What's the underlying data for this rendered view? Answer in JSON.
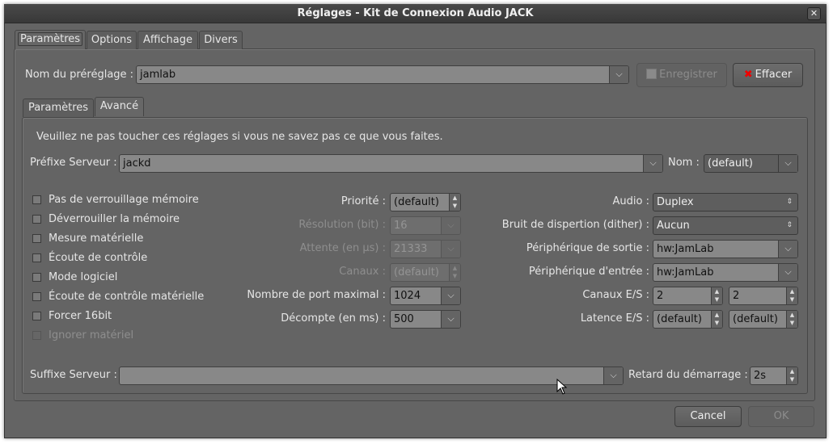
{
  "window": {
    "title": "Réglages - Kit de Connexion Audio JACK",
    "close": "✕"
  },
  "outer_tabs": [
    "Paramètres",
    "Options",
    "Affichage",
    "Divers"
  ],
  "preset": {
    "label": "Nom du préréglage :",
    "value": "jamlab",
    "save": "Enregistrer",
    "delete": "Effacer"
  },
  "inner_tabs": [
    "Paramètres",
    "Avancé"
  ],
  "warning": "Veuillez ne pas toucher ces réglages si vous ne savez pas ce que vous faites.",
  "server_prefix": {
    "label": "Préfixe Serveur :",
    "value": "jackd",
    "name_label": "Nom :",
    "name_value": "(default)"
  },
  "checkboxes": [
    "Pas de verrouillage mémoire",
    "Déverrouiller la mémoire",
    "Mesure matérielle",
    "Écoute de contrôle",
    "Mode logiciel",
    "Écoute de contrôle matérielle",
    "Forcer 16bit",
    "Ignorer matériel"
  ],
  "mid": [
    {
      "label": "Priorité :",
      "value": "(default)"
    },
    {
      "label": "Résolution (bit) :",
      "value": "16"
    },
    {
      "label": "Attente (en µs) :",
      "value": "21333"
    },
    {
      "label": "Canaux :",
      "value": "(default)"
    },
    {
      "label": "Nombre de port maximal :",
      "value": "1024"
    },
    {
      "label": "Décompte (en ms) :",
      "value": "500"
    }
  ],
  "right": [
    {
      "label": "Audio :",
      "value": "Duplex"
    },
    {
      "label": "Bruit de dispertion (dither) :",
      "value": "Aucun"
    },
    {
      "label": "Périphérique de sortie :",
      "value": "hw:JamLab"
    },
    {
      "label": "Périphérique d'entrée :",
      "value": "hw:JamLab"
    },
    {
      "label": "Canaux E/S :",
      "in": "2",
      "out": "2"
    },
    {
      "label": "Latence E/S :",
      "in": "(default)",
      "out": "(default)"
    }
  ],
  "suffix": {
    "label": "Suffixe Serveur :",
    "value": "",
    "delay_label": "Retard du démarrage :",
    "delay_value": "2s"
  },
  "footer": {
    "cancel": "Cancel",
    "ok": "OK"
  }
}
